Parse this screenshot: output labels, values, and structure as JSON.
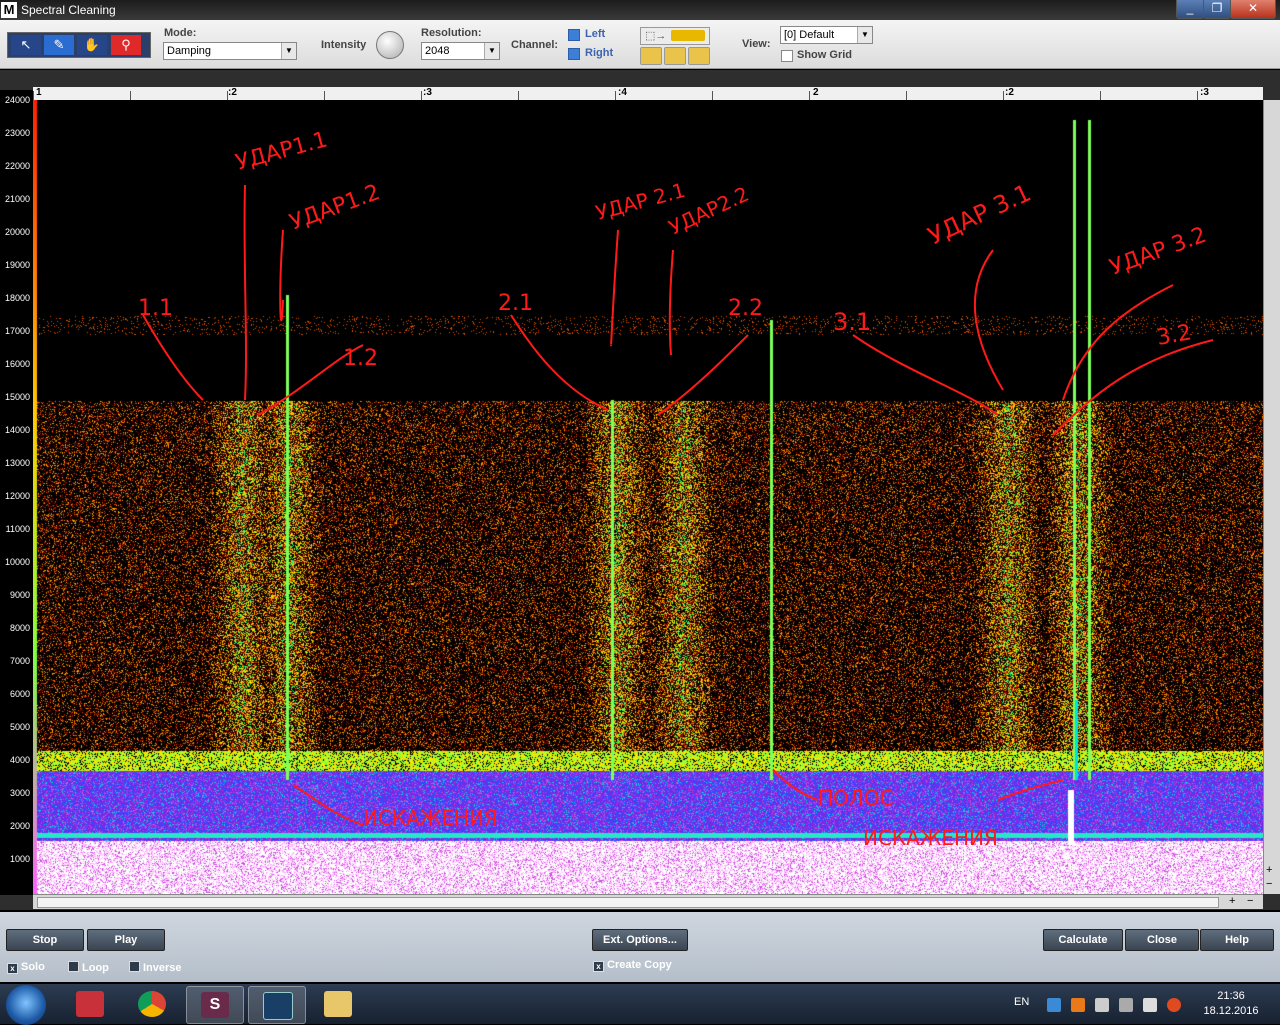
{
  "window": {
    "logo": "M",
    "title": "Spectral Cleaning",
    "minimize": "_",
    "maximize": "❐",
    "close": "✕"
  },
  "toolbar": {
    "tools": [
      {
        "icon": "arrow-cursor-icon",
        "glyph": "↖"
      },
      {
        "icon": "brush-icon",
        "glyph": "✎"
      },
      {
        "icon": "hand-icon",
        "glyph": "✋"
      },
      {
        "icon": "magnifier-icon",
        "glyph": "⚲"
      }
    ],
    "mode_label": "Mode:",
    "mode_value": "Damping",
    "intensity_label": "Intensity",
    "resolution_label": "Resolution:",
    "resolution_value": "2048",
    "channel_label": "Channel:",
    "channel_left": "Left",
    "channel_right": "Right",
    "view_label": "View:",
    "view_value": "[0] Default",
    "show_grid": "Show Grid"
  },
  "freq_axis": {
    "ticks": [
      "24000",
      "23000",
      "22000",
      "21000",
      "20000",
      "19000",
      "18000",
      "17000",
      "16000",
      "15000",
      "14000",
      "13000",
      "12000",
      "11000",
      "10000",
      "9000",
      "8000",
      "7000",
      "6000",
      "5000",
      "4000",
      "3000",
      "2000",
      "1000"
    ]
  },
  "ruler": {
    "labels": [
      {
        "t": "1",
        "major": true
      },
      {
        "t": ":2"
      },
      {
        "t": ":3"
      },
      {
        "t": ":4"
      },
      {
        "t": "2",
        "major": true
      },
      {
        "t": ":2"
      },
      {
        "t": ":3"
      }
    ]
  },
  "annotations": [
    {
      "text": "УДАР1.1"
    },
    {
      "text": "УДАР1.2"
    },
    {
      "text": "1.1"
    },
    {
      "text": "1.2"
    },
    {
      "text": "УДАР 2.1"
    },
    {
      "text": "УДАР2.2"
    },
    {
      "text": "2.1"
    },
    {
      "text": "2.2"
    },
    {
      "text": "УДАР 3.1"
    },
    {
      "text": "УДАР 3.2"
    },
    {
      "text": "3.1"
    },
    {
      "text": "3.2"
    },
    {
      "text": "ИСКАЖЕНИЯ"
    },
    {
      "text": "ПОЛОС"
    },
    {
      "text": "ИСКАЖЕНИЯ"
    }
  ],
  "scroll": {
    "plus": "+",
    "minus": "−"
  },
  "bottom": {
    "stop": "Stop",
    "play": "Play",
    "ext_options": "Ext. Options...",
    "calculate": "Calculate",
    "close": "Close",
    "help": "Help",
    "solo": "Solo",
    "loop": "Loop",
    "inverse": "Inverse",
    "create_copy": "Create Copy",
    "check_mark": "x"
  },
  "taskbar": {
    "lang": "EN",
    "time": "21:36",
    "date": "18.12.2016"
  },
  "colors": {
    "accent": "#2a6cd0",
    "annotation": "#ff1a1a"
  }
}
